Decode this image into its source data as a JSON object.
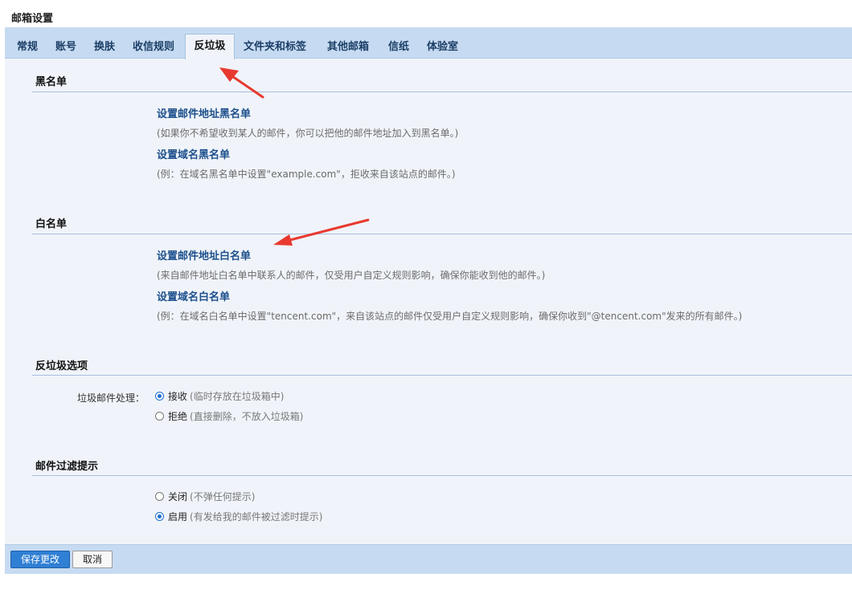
{
  "page": {
    "title": "邮箱设置"
  },
  "tabs": [
    {
      "label": "常规"
    },
    {
      "label": "账号"
    },
    {
      "label": "换肤"
    },
    {
      "label": "收信规则"
    },
    {
      "label": "反垃圾",
      "active": true
    },
    {
      "label": "文件夹和标签"
    },
    {
      "label": "其他邮箱"
    },
    {
      "label": "信纸"
    },
    {
      "label": "体验室"
    }
  ],
  "blacklist": {
    "title": "黑名单",
    "address_link": "设置邮件地址黑名单",
    "address_hint": "(如果你不希望收到某人的邮件，你可以把他的邮件地址加入到黑名单。)",
    "domain_link": "设置域名黑名单",
    "domain_hint": "(例：在域名黑名单中设置\"example.com\"，拒收来自该站点的邮件。)"
  },
  "whitelist": {
    "title": "白名单",
    "address_link": "设置邮件地址白名单",
    "address_hint": "(来自邮件地址白名单中联系人的邮件，仅受用户自定义规则影响，确保你能收到他的邮件。)",
    "domain_link": "设置域名白名单",
    "domain_hint": "(例：在域名白名单中设置\"tencent.com\"，来自该站点的邮件仅受用户自定义规则影响，确保你收到\"@tencent.com\"发来的所有邮件。)"
  },
  "antispam": {
    "title": "反垃圾选项",
    "option_label": "垃圾邮件处理：",
    "options": [
      {
        "label": "接收",
        "note": "(临时存放在垃圾箱中)",
        "checked": true
      },
      {
        "label": "拒绝",
        "note": "(直接删除，不放入垃圾箱)",
        "checked": false
      }
    ]
  },
  "filter_hint": {
    "title": "邮件过滤提示",
    "options": [
      {
        "label": "关闭",
        "note": "(不弹任何提示)",
        "checked": false
      },
      {
        "label": "启用",
        "note": "(有发给我的邮件被过滤时提示)",
        "checked": true
      }
    ]
  },
  "footer": {
    "save_label": "保存更改",
    "cancel_label": "取消"
  },
  "colors": {
    "tabbar": "#c6dbf2",
    "content_bg": "#f0f4fa",
    "link": "#1d4f8c",
    "primary_button": "#2f7fd4",
    "annotation_arrow": "#e8392f"
  }
}
